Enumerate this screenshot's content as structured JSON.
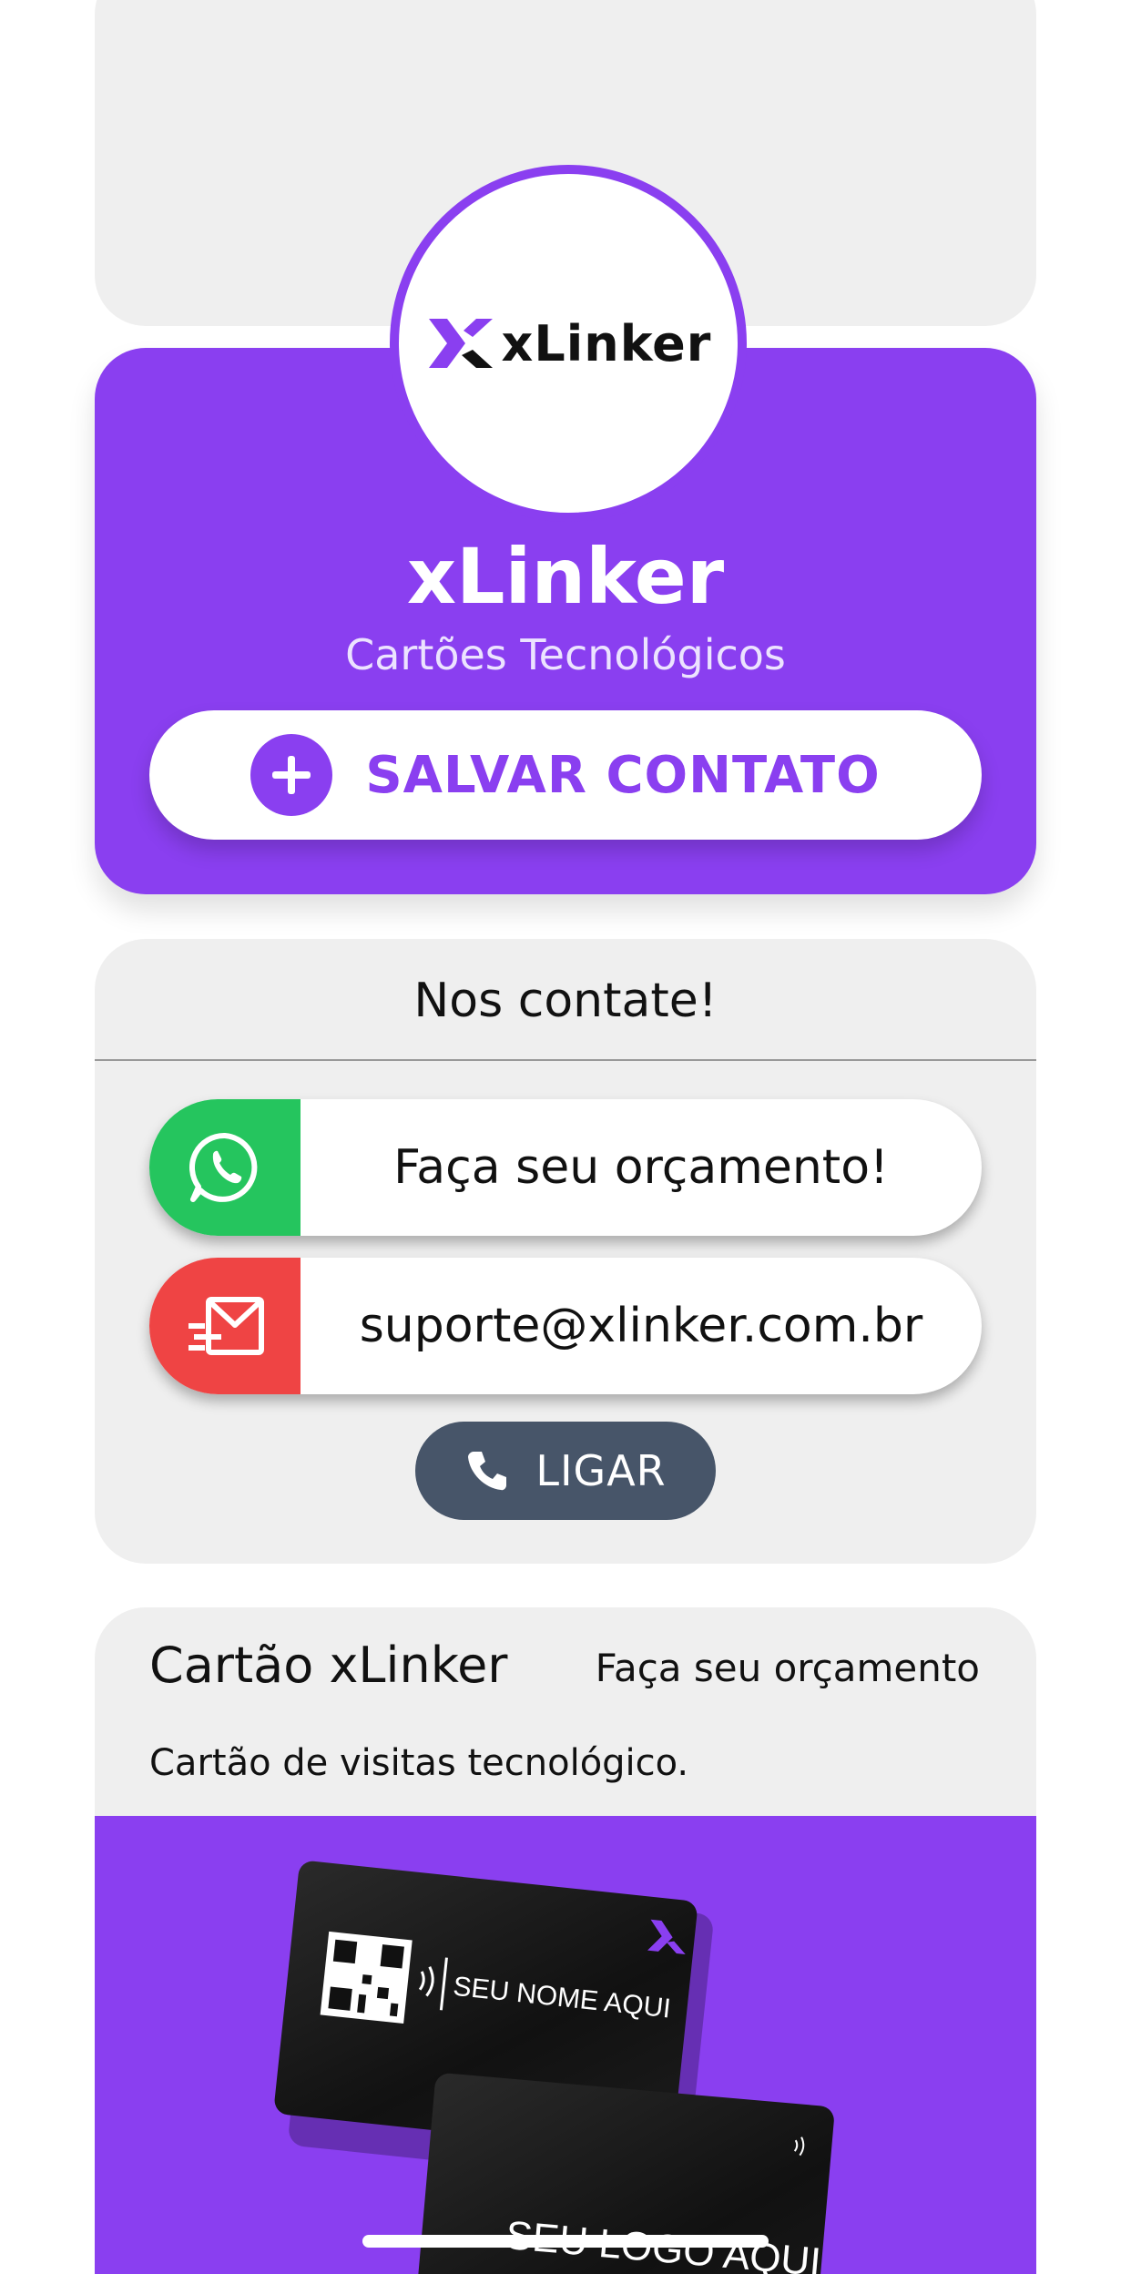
{
  "profile": {
    "logo_text": "xLinker",
    "name": "xLinker",
    "subtitle": "Cartões Tecnológicos",
    "save_label": "SALVAR CONTATO"
  },
  "contact": {
    "title": "Nos contate!",
    "whatsapp_label": "Faça seu orçamento!",
    "email_label": "suporte@xlinker.com.br",
    "call_label": "LIGAR"
  },
  "product": {
    "title": "Cartão xLinker",
    "link_label": "Faça seu orçamento",
    "description": "Cartão de visitas tecnológico.",
    "card_front_text": "SEU NOME AQUI",
    "card_back_text": "SEU LOGO AQUI"
  },
  "colors": {
    "brand_purple": "#8a3ff0",
    "whatsapp_green": "#25c55e",
    "email_red": "#ef4444",
    "call_slate": "#475569",
    "card_grey": "#efefef"
  },
  "icons": {
    "save": "plus-icon",
    "whatsapp": "whatsapp-icon",
    "email": "mail-icon",
    "call": "phone-icon"
  }
}
